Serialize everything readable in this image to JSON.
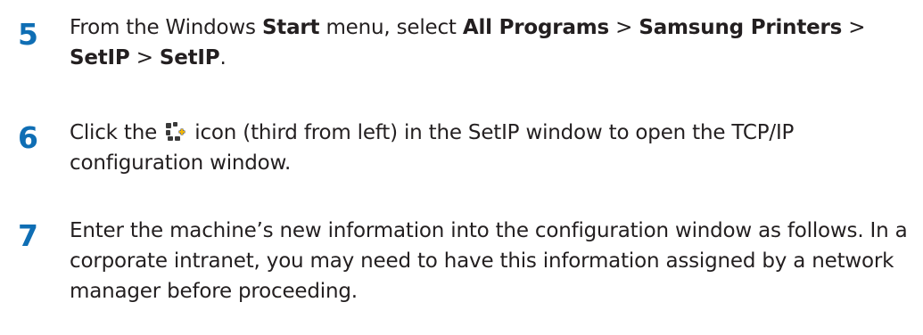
{
  "steps": [
    {
      "number": "5",
      "parts": {
        "a": "From the Windows ",
        "b": "Start",
        "c": " menu, select ",
        "d": "All Programs",
        "e": " > ",
        "f": "Samsung Printers",
        "g": " > ",
        "h": "SetIP",
        "i": " > ",
        "j": "SetIP",
        "k": "."
      }
    },
    {
      "number": "6",
      "parts": {
        "a": "Click the ",
        "icon": "gear-plus-icon",
        "b": " icon (third from left) in the SetIP window to open the TCP/IP configuration window."
      }
    },
    {
      "number": "7",
      "text": "Enter the machine’s new information into the configuration window as follows. In a corporate intranet, you may need to have this information assigned by a network manager before proceeding."
    }
  ],
  "colors": {
    "step_number": "#0f6eb4",
    "body_text": "#231f20",
    "icon_dark": "#3a3a3a",
    "icon_accent": "#f2b705"
  }
}
